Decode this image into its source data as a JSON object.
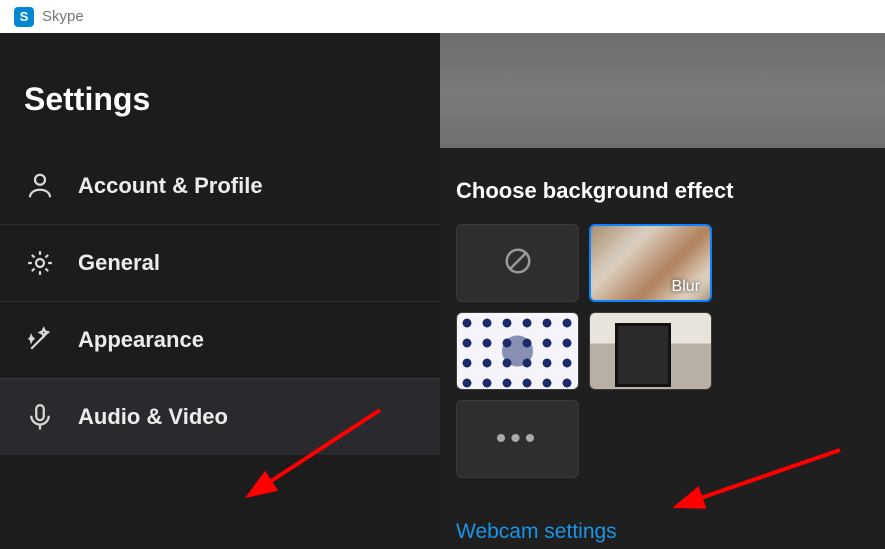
{
  "app": {
    "name": "Skype",
    "logo_letter": "S"
  },
  "sidebar": {
    "title": "Settings",
    "items": [
      {
        "label": "Account & Profile"
      },
      {
        "label": "General"
      },
      {
        "label": "Appearance"
      },
      {
        "label": "Audio & Video"
      }
    ]
  },
  "content": {
    "background_effect_title": "Choose background effect",
    "effects": {
      "blur_label": "Blur"
    },
    "webcam_link": "Webcam settings"
  }
}
